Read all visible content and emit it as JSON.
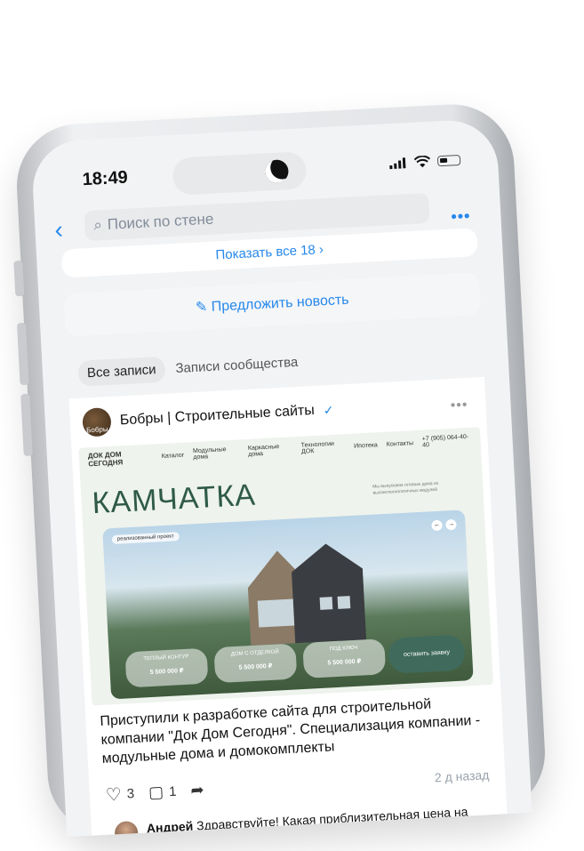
{
  "status": {
    "time": "18:49"
  },
  "search": {
    "placeholder": "Поиск по стене"
  },
  "show_all": "Показать все 18 ›",
  "suggest": "Предложить новость",
  "filters": {
    "all": "Все записи",
    "community": "Записи сообщества"
  },
  "post": {
    "author": "Бобры | Строительные сайты",
    "avatar_label": "Бобры",
    "site": {
      "logo": "ДОК ДОМ СЕГОДНЯ",
      "nav": [
        "Каталог",
        "Модульные дома",
        "Каркасные дома",
        "Технологии ДОК",
        "Ипотека",
        "Контакты"
      ],
      "phone": "+7 (905) 064-40-40",
      "hero": "КАМЧАТКА",
      "blurb": "Мы выпускаем готовые дома из высокотехнологичных модулей",
      "tag": "реализованный проект",
      "pills": [
        {
          "title": "ТЕПЛЫЙ КОНТУР",
          "price": "5 500 000 ₽"
        },
        {
          "title": "ДОМ С ОТДЕЛКОЙ",
          "price": "5 500 000 ₽"
        },
        {
          "title": "ПОД КЛЮЧ",
          "price": "5 500 000 ₽"
        }
      ],
      "cta": "оставить заявку"
    },
    "text": "Приступили к разработке сайта для строительной компании \"Док Дом Сегодня\". Специализация компании - модульные дома и домокомплекты",
    "likes": "3",
    "comments": "1",
    "ago": "2 д назад"
  },
  "comment": {
    "name": "Андрей",
    "text": "Здравствуйте! Какая приблизительная цена на разработку такого сайта?"
  }
}
